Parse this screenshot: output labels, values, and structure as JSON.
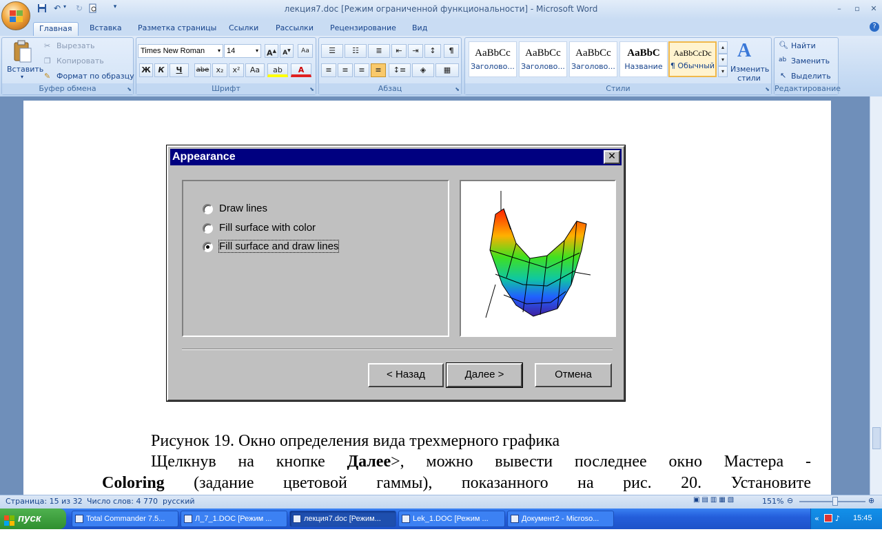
{
  "window": {
    "title": "лекция7.doc [Режим ограниченной функциональности] - Microsoft Word",
    "qat": [
      "save-icon",
      "undo-icon",
      "redo-icon",
      "print-preview-icon"
    ]
  },
  "tabs": [
    {
      "label": "Главная",
      "active": true
    },
    {
      "label": "Вставка"
    },
    {
      "label": "Разметка страницы"
    },
    {
      "label": "Ссылки"
    },
    {
      "label": "Рассылки"
    },
    {
      "label": "Рецензирование"
    },
    {
      "label": "Вид"
    }
  ],
  "clipboard": {
    "paste": "Вставить",
    "cut": "Вырезать",
    "copy": "Копировать",
    "format_painter": "Формат по образцу",
    "label": "Буфер обмена"
  },
  "font": {
    "name": "Times New Roman",
    "size": "14",
    "label": "Шрифт",
    "bold": "Ж",
    "italic": "К",
    "underline": "Ч",
    "strike": "abe",
    "sub": "x₂",
    "sup": "x²",
    "case": "Aa"
  },
  "paragraph": {
    "label": "Абзац",
    "show_marks": "¶"
  },
  "styles": {
    "label": "Стили",
    "items": [
      {
        "sample": "AaBbCc",
        "name": "Заголово..."
      },
      {
        "sample": "AaBbCc",
        "name": "Заголово..."
      },
      {
        "sample": "AaBbCc",
        "name": "Заголово..."
      },
      {
        "sample": "AaBbC",
        "name": "Название"
      },
      {
        "sample": "AaBbCcDc",
        "name": "¶ Обычный"
      }
    ],
    "change_styles": "Изменить стили"
  },
  "editing": {
    "find": "Найти",
    "replace": "Заменить",
    "select": "Выделить",
    "label": "Редактирование"
  },
  "dialog": {
    "title": "Appearance",
    "options": [
      {
        "label": "Draw lines",
        "selected": false
      },
      {
        "label": "Fill surface with color",
        "selected": false
      },
      {
        "label": "Fill surface and draw lines",
        "selected": true
      }
    ],
    "back": "< Назад",
    "next": "Далее >",
    "cancel": "Отмена"
  },
  "doc": {
    "caption": "Рисунок 19. Окно определения вида трехмерного графика",
    "p1_a": "Щелкнув на кнопке ",
    "p1_b": "Далее",
    "p1_c": ">,   можно вывести последнее окно Мастера -",
    "p2_a": "Coloring",
    "p2_b": " (задание цветовой гаммы), показанного на рис. 20. Установите"
  },
  "status": {
    "page": "Страница: 15 из 32",
    "words": "Число слов: 4 770",
    "lang": "русский",
    "zoom": "151%"
  },
  "taskbar": {
    "start": "пуск",
    "tasks": [
      {
        "label": "Total Commander 7.5..."
      },
      {
        "label": "Л_7_1.DOC [Режим ..."
      },
      {
        "label": "лекция7.doc [Режим...",
        "active": true
      },
      {
        "label": "Lek_1.DOC [Режим ..."
      },
      {
        "label": "Документ2 - Microso..."
      }
    ],
    "clock": "15:45"
  }
}
